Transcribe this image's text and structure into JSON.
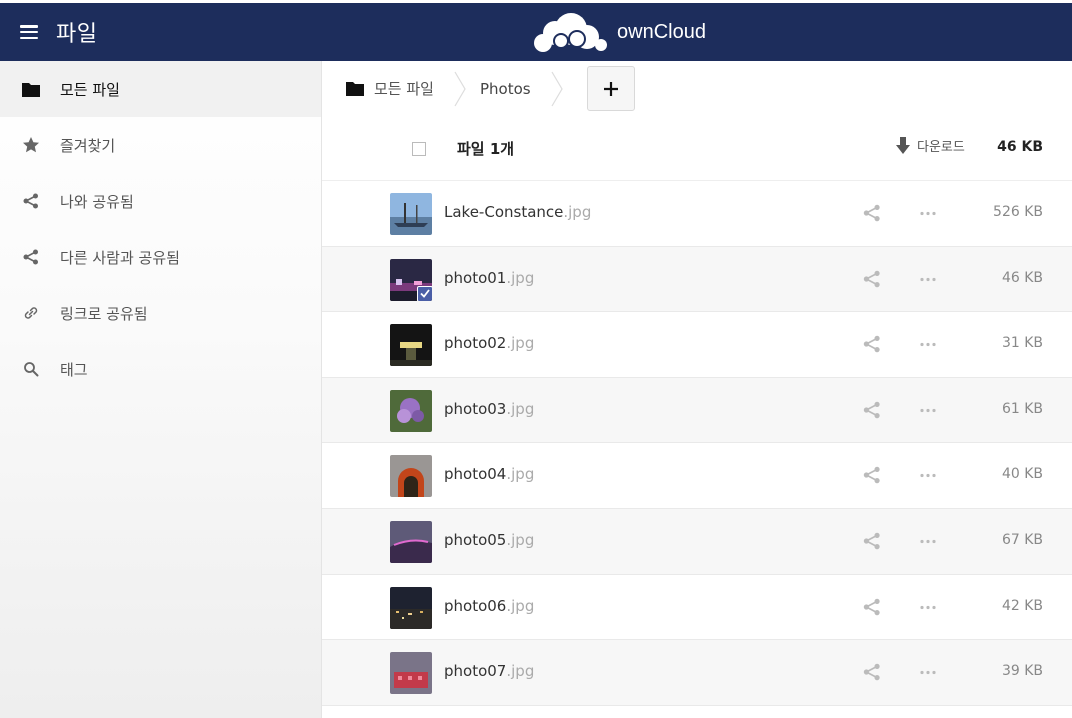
{
  "header": {
    "app_title": "파일",
    "brand_name": "ownCloud",
    "bg_color": "#1d2d5c"
  },
  "sidebar": {
    "items": [
      {
        "label": "모든 파일",
        "icon": "folder-icon",
        "active": true
      },
      {
        "label": "즐겨찾기",
        "icon": "star-icon"
      },
      {
        "label": "나와 공유됨",
        "icon": "share-icon"
      },
      {
        "label": "다른 사람과 공유됨",
        "icon": "share-icon"
      },
      {
        "label": "링크로 공유됨",
        "icon": "link-icon"
      },
      {
        "label": "태그",
        "icon": "search-icon"
      }
    ]
  },
  "breadcrumb": {
    "root_label": "모든 파일",
    "current": "Photos"
  },
  "list_header": {
    "selection_label": "파일 1개",
    "download_label": "다운로드",
    "total_size": "46 KB"
  },
  "files": [
    {
      "base": "Lake-Constance",
      "ext": ".jpg",
      "size": "526 KB",
      "selected": false
    },
    {
      "base": "photo01",
      "ext": ".jpg",
      "size": "46 KB",
      "selected": true
    },
    {
      "base": "photo02",
      "ext": ".jpg",
      "size": "31 KB",
      "selected": false
    },
    {
      "base": "photo03",
      "ext": ".jpg",
      "size": "61 KB",
      "selected": false
    },
    {
      "base": "photo04",
      "ext": ".jpg",
      "size": "40 KB",
      "selected": false
    },
    {
      "base": "photo05",
      "ext": ".jpg",
      "size": "67 KB",
      "selected": false
    },
    {
      "base": "photo06",
      "ext": ".jpg",
      "size": "42 KB",
      "selected": false
    },
    {
      "base": "photo07",
      "ext": ".jpg",
      "size": "39 KB",
      "selected": false
    }
  ]
}
